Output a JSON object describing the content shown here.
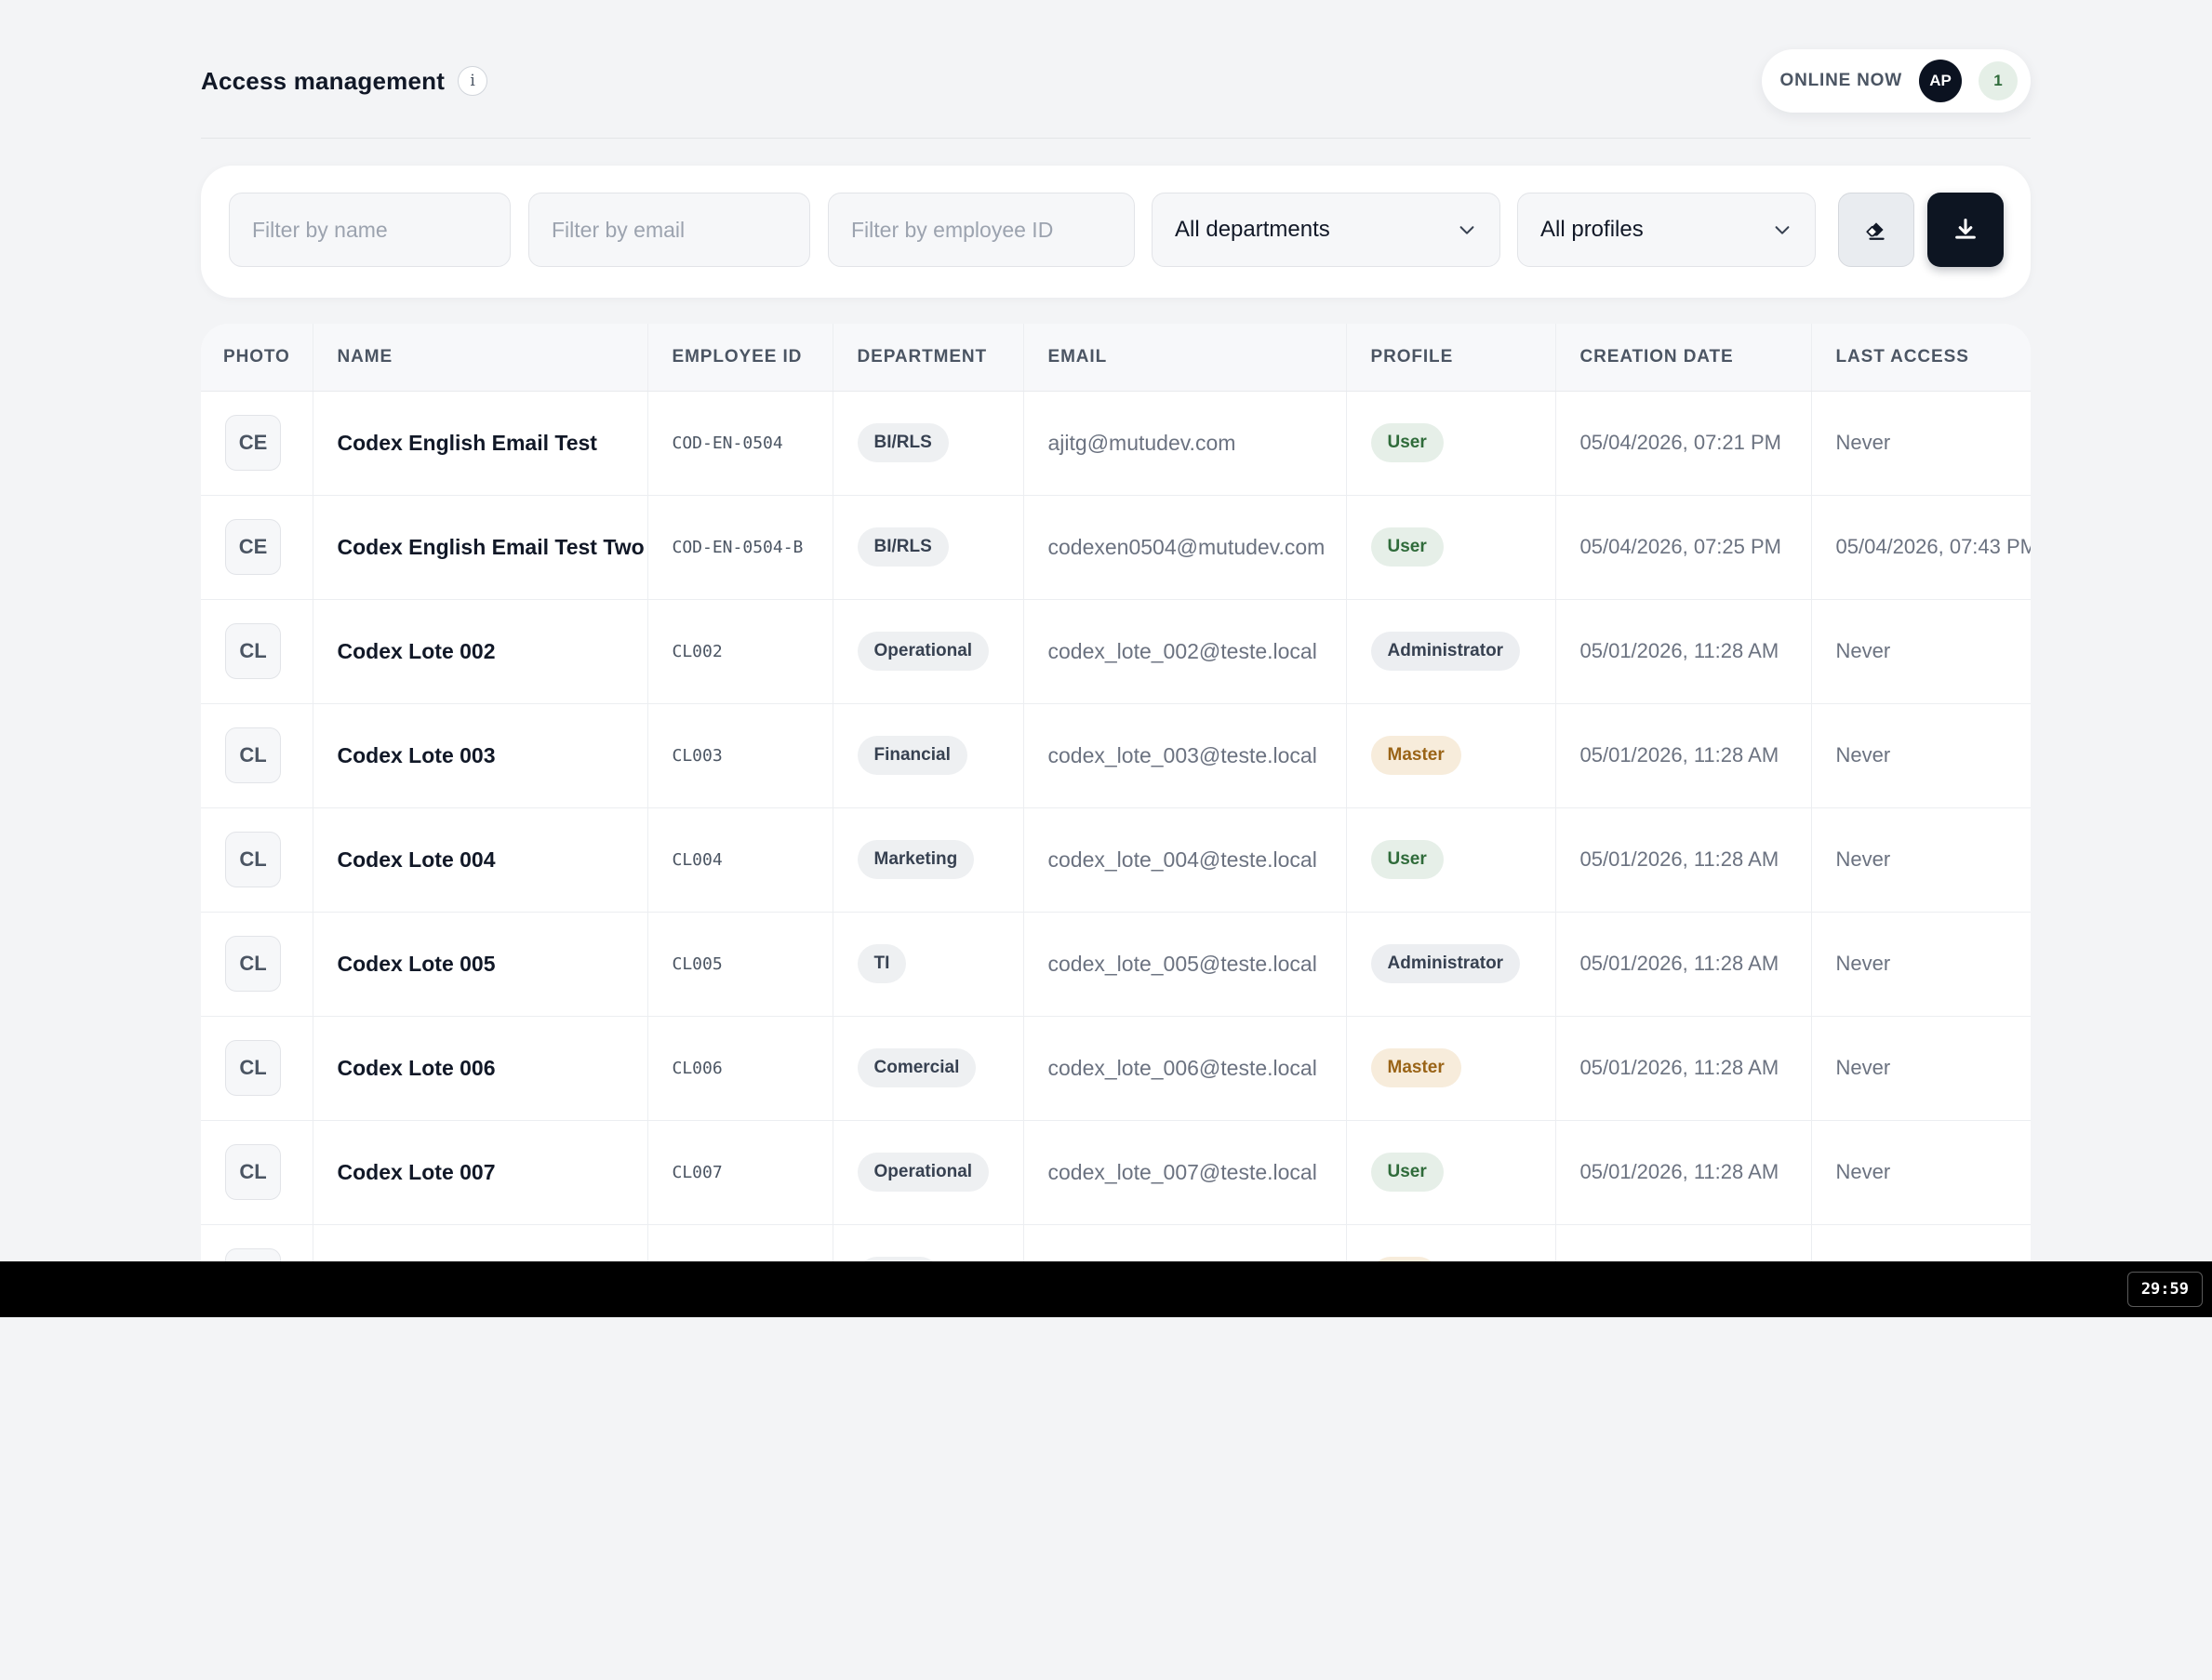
{
  "header": {
    "title": "Access management",
    "info_icon": "i",
    "online_label": "ONLINE NOW",
    "avatar_initials": "AP",
    "online_count": "1"
  },
  "filters": {
    "name_placeholder": "Filter by name",
    "email_placeholder": "Filter by email",
    "employee_id_placeholder": "Filter by employee ID",
    "department_selected": "All departments",
    "profile_selected": "All profiles",
    "clear_icon": "eraser-icon",
    "export_icon": "download-icon"
  },
  "table": {
    "columns": [
      "PHOTO",
      "NAME",
      "EMPLOYEE ID",
      "DEPARTMENT",
      "EMAIL",
      "PROFILE",
      "CREATION DATE",
      "LAST ACCESS"
    ],
    "rows": [
      {
        "initials": "CE",
        "name": "Codex English Email Test",
        "employee_id": "COD-EN-0504",
        "department": "BI/RLS",
        "email": "ajitg@mutudev.com",
        "profile": "User",
        "created": "05/04/2026, 07:21 PM",
        "last_access": "Never"
      },
      {
        "initials": "CE",
        "name": "Codex English Email Test Two",
        "employee_id": "COD-EN-0504-B",
        "department": "BI/RLS",
        "email": "codexen0504@mutudev.com",
        "profile": "User",
        "created": "05/04/2026, 07:25 PM",
        "last_access": "05/04/2026, 07:43 PM"
      },
      {
        "initials": "CL",
        "name": "Codex Lote 002",
        "employee_id": "CL002",
        "department": "Operational",
        "email": "codex_lote_002@teste.local",
        "profile": "Administrator",
        "created": "05/01/2026, 11:28 AM",
        "last_access": "Never"
      },
      {
        "initials": "CL",
        "name": "Codex Lote 003",
        "employee_id": "CL003",
        "department": "Financial",
        "email": "codex_lote_003@teste.local",
        "profile": "Master",
        "created": "05/01/2026, 11:28 AM",
        "last_access": "Never"
      },
      {
        "initials": "CL",
        "name": "Codex Lote 004",
        "employee_id": "CL004",
        "department": "Marketing",
        "email": "codex_lote_004@teste.local",
        "profile": "User",
        "created": "05/01/2026, 11:28 AM",
        "last_access": "Never"
      },
      {
        "initials": "CL",
        "name": "Codex Lote 005",
        "employee_id": "CL005",
        "department": "TI",
        "email": "codex_lote_005@teste.local",
        "profile": "Administrator",
        "created": "05/01/2026, 11:28 AM",
        "last_access": "Never"
      },
      {
        "initials": "CL",
        "name": "Codex Lote 006",
        "employee_id": "CL006",
        "department": "Comercial",
        "email": "codex_lote_006@teste.local",
        "profile": "Master",
        "created": "05/01/2026, 11:28 AM",
        "last_access": "Never"
      },
      {
        "initials": "CL",
        "name": "Codex Lote 007",
        "employee_id": "CL007",
        "department": "Operational",
        "email": "codex_lote_007@teste.local",
        "profile": "User",
        "created": "05/01/2026, 11:28 AM",
        "last_access": "Never"
      }
    ]
  },
  "colors": {
    "background": "#f3f4f6",
    "accent_dark": "#0d1522",
    "user_chip_text": "#2f6b3a",
    "master_chip_text": "#9a6417"
  },
  "timer": "29:59"
}
